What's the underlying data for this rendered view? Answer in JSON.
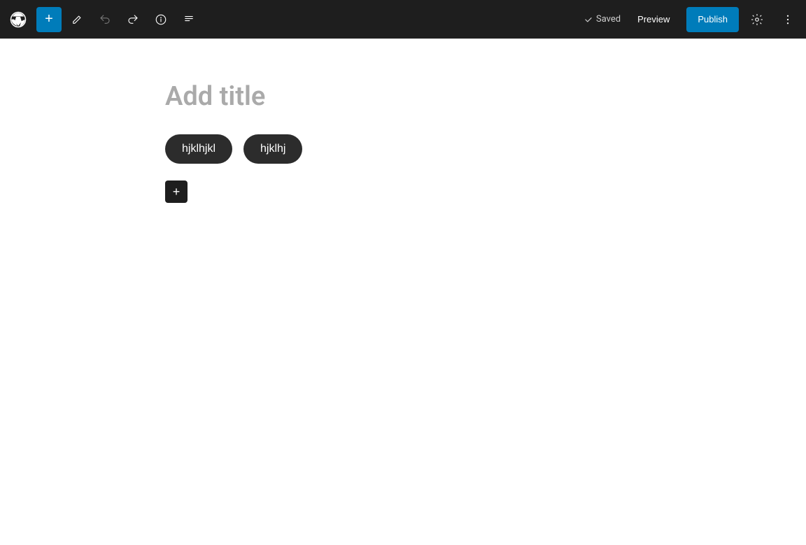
{
  "toolbar": {
    "add_label": "+",
    "saved_label": "Saved",
    "preview_label": "Preview",
    "publish_label": "Publish"
  },
  "editor": {
    "title_placeholder": "Add title",
    "tags": [
      {
        "label": "hjklhjkl"
      },
      {
        "label": "hjklhj"
      }
    ],
    "add_block_label": "+"
  }
}
